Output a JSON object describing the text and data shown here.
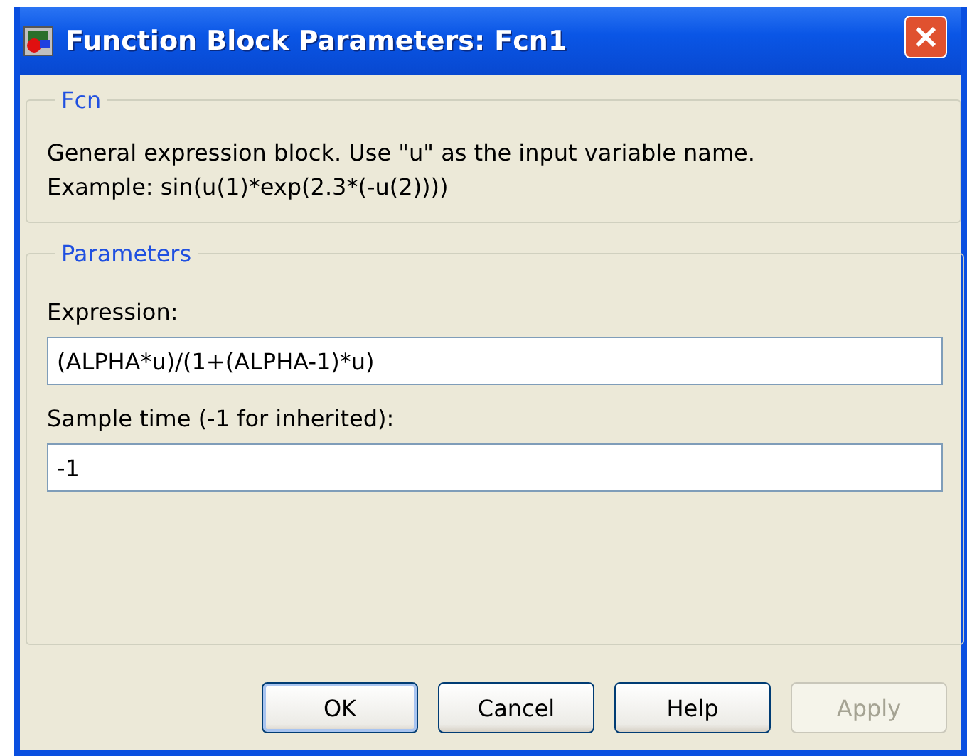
{
  "window": {
    "title": "Function Block Parameters: Fcn1"
  },
  "description_group": {
    "title": "Fcn",
    "lines": [
      "General expression block. Use \"u\" as the input variable name.",
      "Example: sin(u(1)*exp(2.3*(-u(2))))"
    ]
  },
  "parameters_group": {
    "title": "Parameters",
    "fields": [
      {
        "label": "Expression:",
        "value": "(ALPHA*u)/(1+(ALPHA-1)*u)"
      },
      {
        "label": "Sample time (-1 for inherited):",
        "value": "-1"
      }
    ]
  },
  "buttons": [
    {
      "label": "OK",
      "default": true,
      "disabled": false
    },
    {
      "label": "Cancel",
      "default": false,
      "disabled": false
    },
    {
      "label": "Help",
      "default": false,
      "disabled": false
    },
    {
      "label": "Apply",
      "default": false,
      "disabled": true
    }
  ]
}
